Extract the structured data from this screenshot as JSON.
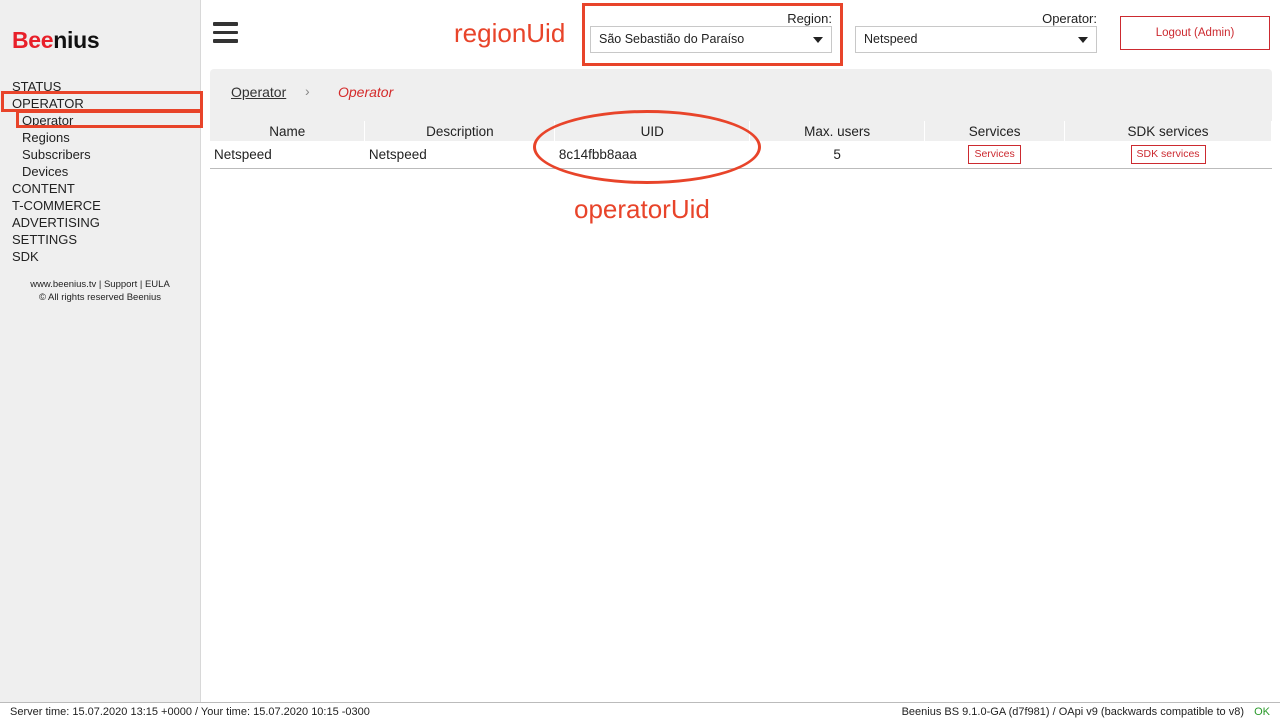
{
  "logo": {
    "part1": "Bee",
    "part2": "nius"
  },
  "sidebar": {
    "items": [
      {
        "label": "STATUS",
        "level": 0
      },
      {
        "label": "OPERATOR",
        "level": 0
      },
      {
        "label": "Operator",
        "level": 1
      },
      {
        "label": "Regions",
        "level": 1
      },
      {
        "label": "Subscribers",
        "level": 1
      },
      {
        "label": "Devices",
        "level": 1
      },
      {
        "label": "CONTENT",
        "level": 0
      },
      {
        "label": "T-COMMERCE",
        "level": 0
      },
      {
        "label": "ADVERTISING",
        "level": 0
      },
      {
        "label": "SETTINGS",
        "level": 0
      },
      {
        "label": "SDK",
        "level": 0
      }
    ],
    "footer_line1": "www.beenius.tv | Support | EULA",
    "footer_line2": "© All rights reserved Beenius"
  },
  "header": {
    "region_label": "Region:",
    "region_value": "São Sebastião do Paraíso",
    "operator_label": "Operator:",
    "operator_value": "Netspeed",
    "logout_label": "Logout (Admin)"
  },
  "annotations": {
    "region_uid": "regionUid",
    "operator_uid": "operatorUid"
  },
  "breadcrumb": {
    "root": "Operator",
    "separator": "›",
    "current": "Operator"
  },
  "table": {
    "headers": [
      "Name",
      "Description",
      "UID",
      "Max. users",
      "Services",
      "SDK services"
    ],
    "rows": [
      {
        "name": "Netspeed",
        "description": "Netspeed",
        "uid": "8c14fbb8aaa",
        "max_users": "5",
        "services": "Services",
        "sdk_services": "SDK services"
      }
    ]
  },
  "status": {
    "left": "Server time: 15.07.2020 13:15 +0000 / Your time: 15.07.2020 10:15 -0300",
    "right": "Beenius BS 9.1.0-GA (d7f981) / OApi v9 (backwards compatible to v8)",
    "ok": "OK"
  },
  "colors": {
    "brand_red": "#e8202a",
    "annotation": "#e8442a",
    "ok_green": "#2a9a2a"
  }
}
